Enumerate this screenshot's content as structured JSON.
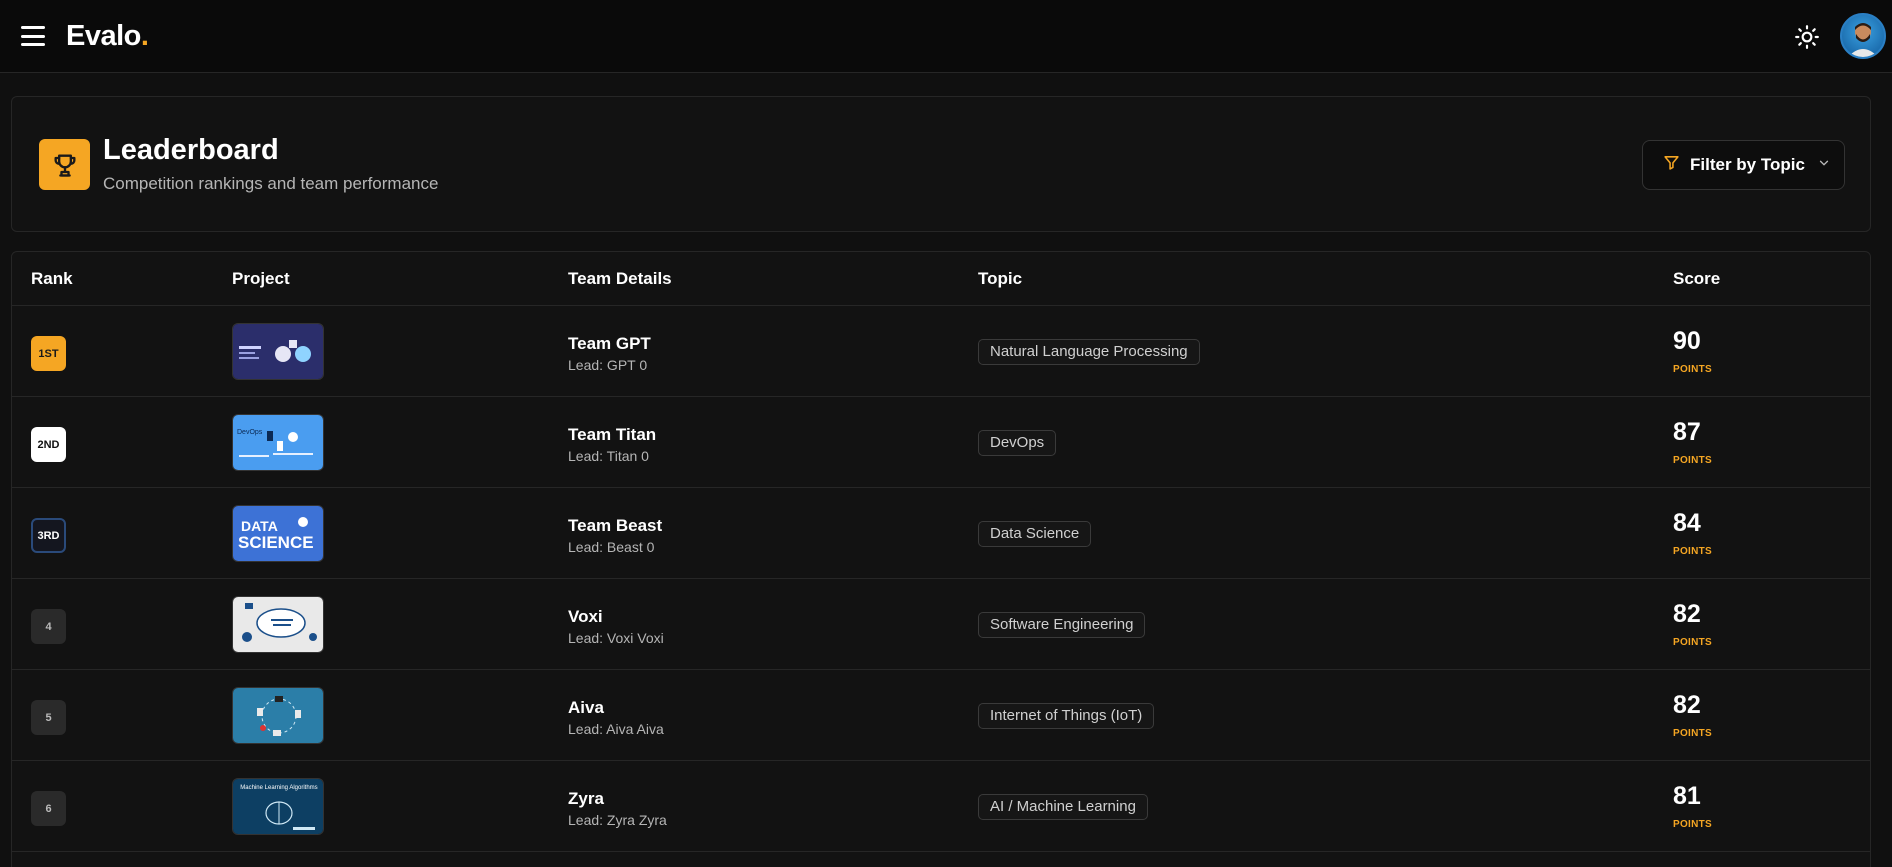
{
  "app": {
    "logo_text": "Evalo",
    "logo_dot": "."
  },
  "header": {
    "title": "Leaderboard",
    "subtitle": "Competition rankings and team performance",
    "filter_label": "Filter by Topic"
  },
  "table": {
    "columns": {
      "rank": "Rank",
      "project": "Project",
      "team": "Team Details",
      "topic": "Topic",
      "score": "Score"
    },
    "rows": [
      {
        "rank": "1ST",
        "team": "Team GPT",
        "lead": "Lead: GPT 0",
        "topic": "Natural Language Processing",
        "score": "90",
        "points": "POINTS"
      },
      {
        "rank": "2ND",
        "team": "Team Titan",
        "lead": "Lead: Titan 0",
        "topic": "DevOps",
        "score": "87",
        "points": "POINTS"
      },
      {
        "rank": "3RD",
        "team": "Team Beast",
        "lead": "Lead: Beast 0",
        "topic": "Data Science",
        "score": "84",
        "points": "POINTS"
      },
      {
        "rank": "4",
        "team": "Voxi",
        "lead": "Lead: Voxi Voxi",
        "topic": "Software Engineering",
        "score": "82",
        "points": "POINTS"
      },
      {
        "rank": "5",
        "team": "Aiva",
        "lead": "Lead: Aiva Aiva",
        "topic": "Internet of Things (IoT)",
        "score": "82",
        "points": "POINTS"
      },
      {
        "rank": "6",
        "team": "Zyra",
        "lead": "Lead: Zyra Zyra",
        "topic": "AI / Machine Learning",
        "score": "81",
        "points": "POINTS"
      }
    ]
  },
  "thumbnails": {
    "row2": "DevOps",
    "row3_line1": "DATA",
    "row3_line2": "SCIENCE",
    "row6": "Machine Learning Algorithms"
  },
  "colors": {
    "accent": "#f5a623",
    "background": "#101010",
    "card": "#121212"
  },
  "icons": {
    "menu": "menu-icon",
    "theme": "sun-icon",
    "trophy": "trophy-icon",
    "filter": "filter-icon",
    "chevron": "chevron-down-icon"
  }
}
